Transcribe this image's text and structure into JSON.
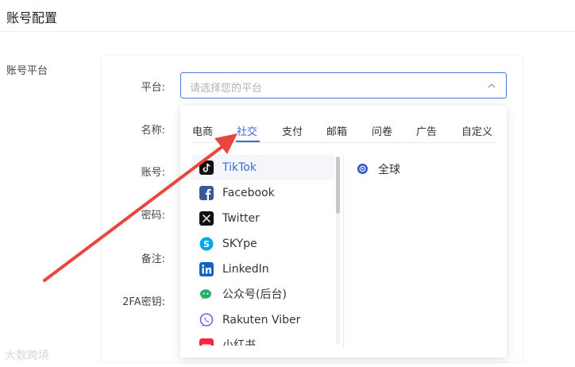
{
  "page": {
    "title": "账号配置",
    "section_label": "账号平台"
  },
  "form": {
    "labels": [
      "平台:",
      "名称:",
      "账号:",
      "密码:",
      "备注:",
      "2FA密钥:"
    ],
    "platform_placeholder": "请选择您的平台"
  },
  "dropdown": {
    "tabs": [
      "电商",
      "社交",
      "支付",
      "邮箱",
      "问卷",
      "广告",
      "自定义"
    ],
    "active_tab": "社交",
    "items": [
      "TikTok",
      "Facebook",
      "Twitter",
      "SKYpe",
      "LinkedIn",
      "公众号(后台)",
      "Rakuten Viber",
      "小红书"
    ],
    "selected_item": "TikTok",
    "region": "全球"
  },
  "watermark": "大数跨境",
  "colors": {
    "accent": "#3b6ad8",
    "arrow": "#e8463e"
  },
  "icons": [
    "chevron-up-icon",
    "tiktok-icon",
    "facebook-icon",
    "twitter-x-icon",
    "skype-icon",
    "linkedin-icon",
    "wechat-icon",
    "viber-icon",
    "xiaohongshu-icon",
    "globe-icon"
  ]
}
